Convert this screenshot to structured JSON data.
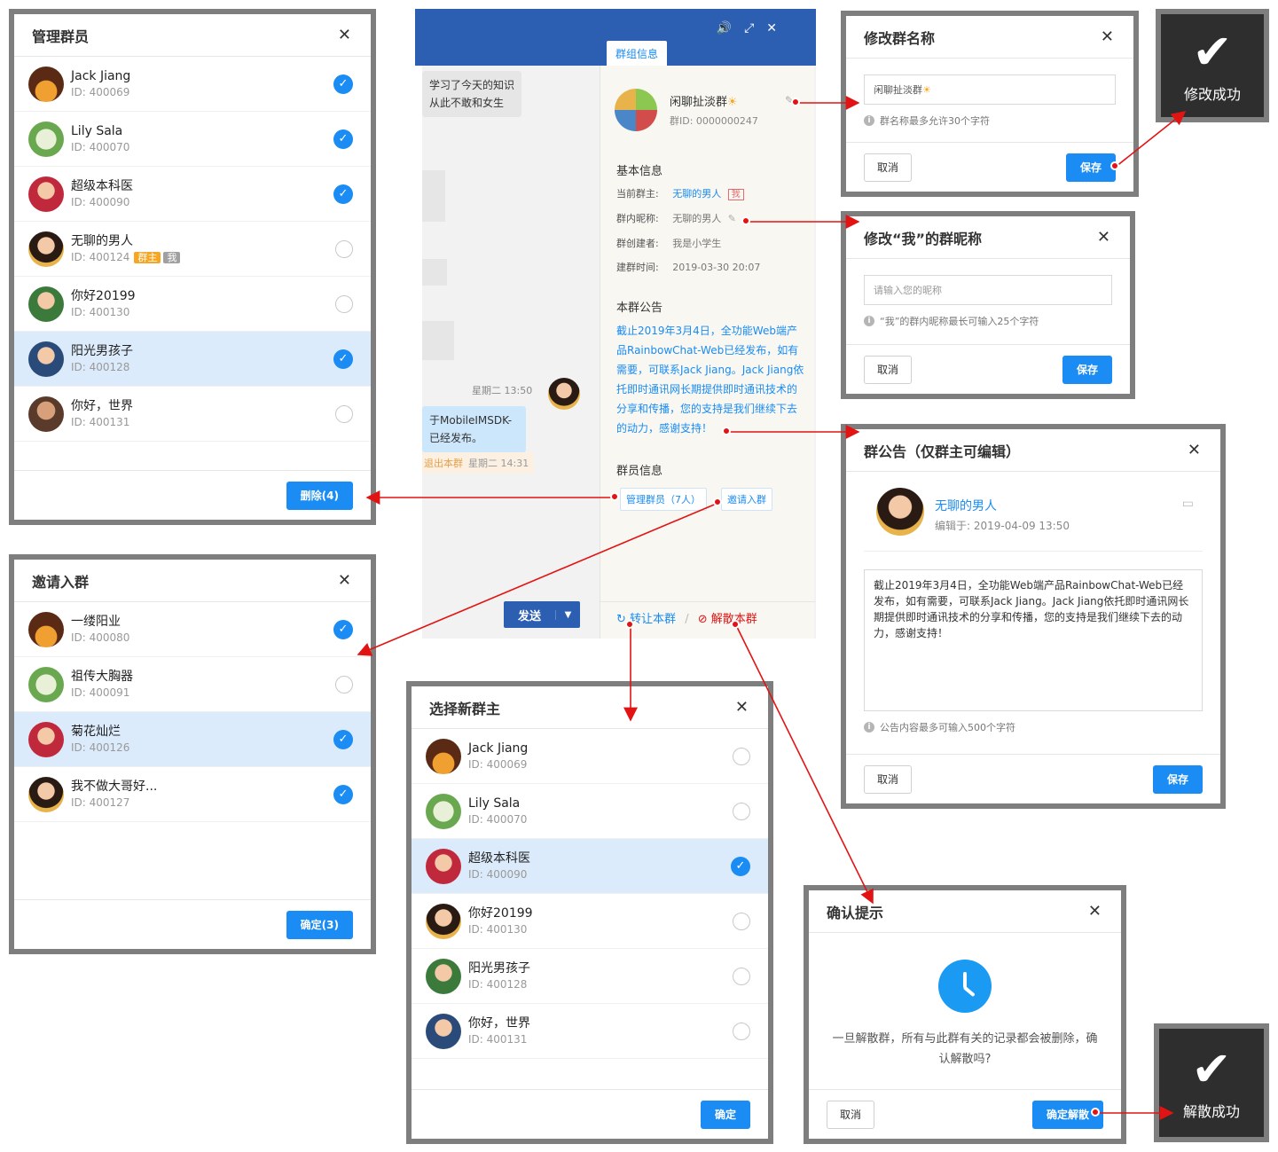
{
  "manage_members": {
    "title": "管理群员",
    "members": [
      {
        "name": "Jack Jiang",
        "id": "ID: 400069",
        "checked": true,
        "selected": false
      },
      {
        "name": "Lily Sala",
        "id": "ID: 400070",
        "checked": true,
        "selected": false
      },
      {
        "name": "超级本科医",
        "id": "ID: 400090",
        "checked": true,
        "selected": false
      },
      {
        "name": "无聊的男人",
        "id": "ID: 400124",
        "checked": false,
        "selected": false,
        "badges": [
          "群主",
          "我"
        ]
      },
      {
        "name": "你好20199",
        "id": "ID: 400130",
        "checked": false,
        "selected": false
      },
      {
        "name": "阳光男孩子",
        "id": "ID: 400128",
        "checked": true,
        "selected": true
      },
      {
        "name": "你好，世界",
        "id": "ID: 400131",
        "checked": false,
        "selected": false
      }
    ],
    "delete_label": "删除(4)"
  },
  "invite": {
    "title": "邀请入群",
    "members": [
      {
        "name": "一缕阳业",
        "id": "ID: 400080",
        "checked": true,
        "selected": false
      },
      {
        "name": "祖传大胸器",
        "id": "ID: 400091",
        "checked": false,
        "selected": false
      },
      {
        "name": "菊花灿烂",
        "id": "ID: 400126",
        "checked": true,
        "selected": true
      },
      {
        "name": "我不做大哥好...",
        "id": "ID: 400127",
        "checked": true,
        "selected": false
      }
    ],
    "confirm_label": "确定(3)"
  },
  "new_owner": {
    "title": "选择新群主",
    "members": [
      {
        "name": "Jack Jiang",
        "id": "ID: 400069",
        "checked": false,
        "selected": false
      },
      {
        "name": "Lily Sala",
        "id": "ID: 400070",
        "checked": false,
        "selected": false
      },
      {
        "name": "超级本科医",
        "id": "ID: 400090",
        "checked": true,
        "selected": true
      },
      {
        "name": "你好20199",
        "id": "ID: 400130",
        "checked": false,
        "selected": false
      },
      {
        "name": "阳光男孩子",
        "id": "ID: 400128",
        "checked": false,
        "selected": false
      },
      {
        "name": "你好，世界",
        "id": "ID: 400131",
        "checked": false,
        "selected": false
      }
    ],
    "confirm_label": "确定"
  },
  "rename": {
    "title": "修改群名称",
    "value": "闲聊扯淡群",
    "hint": "群名称最多允许30个字符",
    "cancel": "取消",
    "save": "保存"
  },
  "nickname": {
    "title": "修改“我”的群昵称",
    "placeholder": "请输入您的昵称",
    "hint": "“我”的群内昵称最长可输入25个字符",
    "cancel": "取消",
    "save": "保存"
  },
  "notice": {
    "title": "群公告（仅群主可编辑）",
    "author": "无聊的男人",
    "edited": "编辑于: 2019-04-09 13:50",
    "content": "截止2019年3月4日，全功能Web端产品RainbowChat-Web已经发布，如有需要，可联系Jack Jiang。Jack Jiang依托即时通讯网长期提供即时通讯技术的分享和传播，您的支持是我们继续下去的动力，感谢支持！",
    "hint": "公告内容最多可输入500个字符",
    "cancel": "取消",
    "save": "保存"
  },
  "confirm": {
    "title": "确认提示",
    "message": "一旦解散群，所有与此群有关的记录都会被删除，确认解散吗?",
    "cancel": "取消",
    "ok": "确定解散"
  },
  "toasts": {
    "rename_ok": "修改成功",
    "dissolve_ok": "解散成功"
  },
  "chat": {
    "tab": "群组信息",
    "msg1_l1": "学习了今天的知识",
    "msg1_l2": "从此不敢和女生",
    "time1": "星期二 13:50",
    "msg2_l1": "于MobileIMSDK-",
    "msg2_l2": "已经发布。",
    "quit_tip": "退出本群",
    "time2": "星期二 14:31",
    "send": "发送",
    "group_name": "闲聊扯淡群",
    "group_id": "群ID: 0000000247",
    "basic_title": "基本信息",
    "owner_label": "当前群主:",
    "owner_value": "无聊的男人",
    "owner_tag": "我",
    "nick_label": "群内昵称:",
    "nick_value": "无聊的男人",
    "creator_label": "群创建者:",
    "creator_value": "我是小学生",
    "time_label": "建群时间:",
    "time_value": "2019-03-30 20:07",
    "notice_title": "本群公告",
    "notice_lines": [
      "截止2019年3月4日，全功能Web端产",
      "品RainbowChat-Web已经发布，如有",
      "需要，可联系Jack Jiang。Jack Jiang依",
      "托即时通讯网长期提供即时通讯技术的",
      "分享和传播，您的支持是我们继续下去",
      "的动力，感谢支持！"
    ],
    "members_title": "群员信息",
    "manage_btn": "管理群员（7人）",
    "invite_btn": "邀请入群",
    "transfer": "转让本群",
    "dissolve": "解散本群"
  },
  "colors": {
    "accent": "#1a8cf3",
    "header": "#2c5fb1",
    "arrow": "#e21313"
  }
}
